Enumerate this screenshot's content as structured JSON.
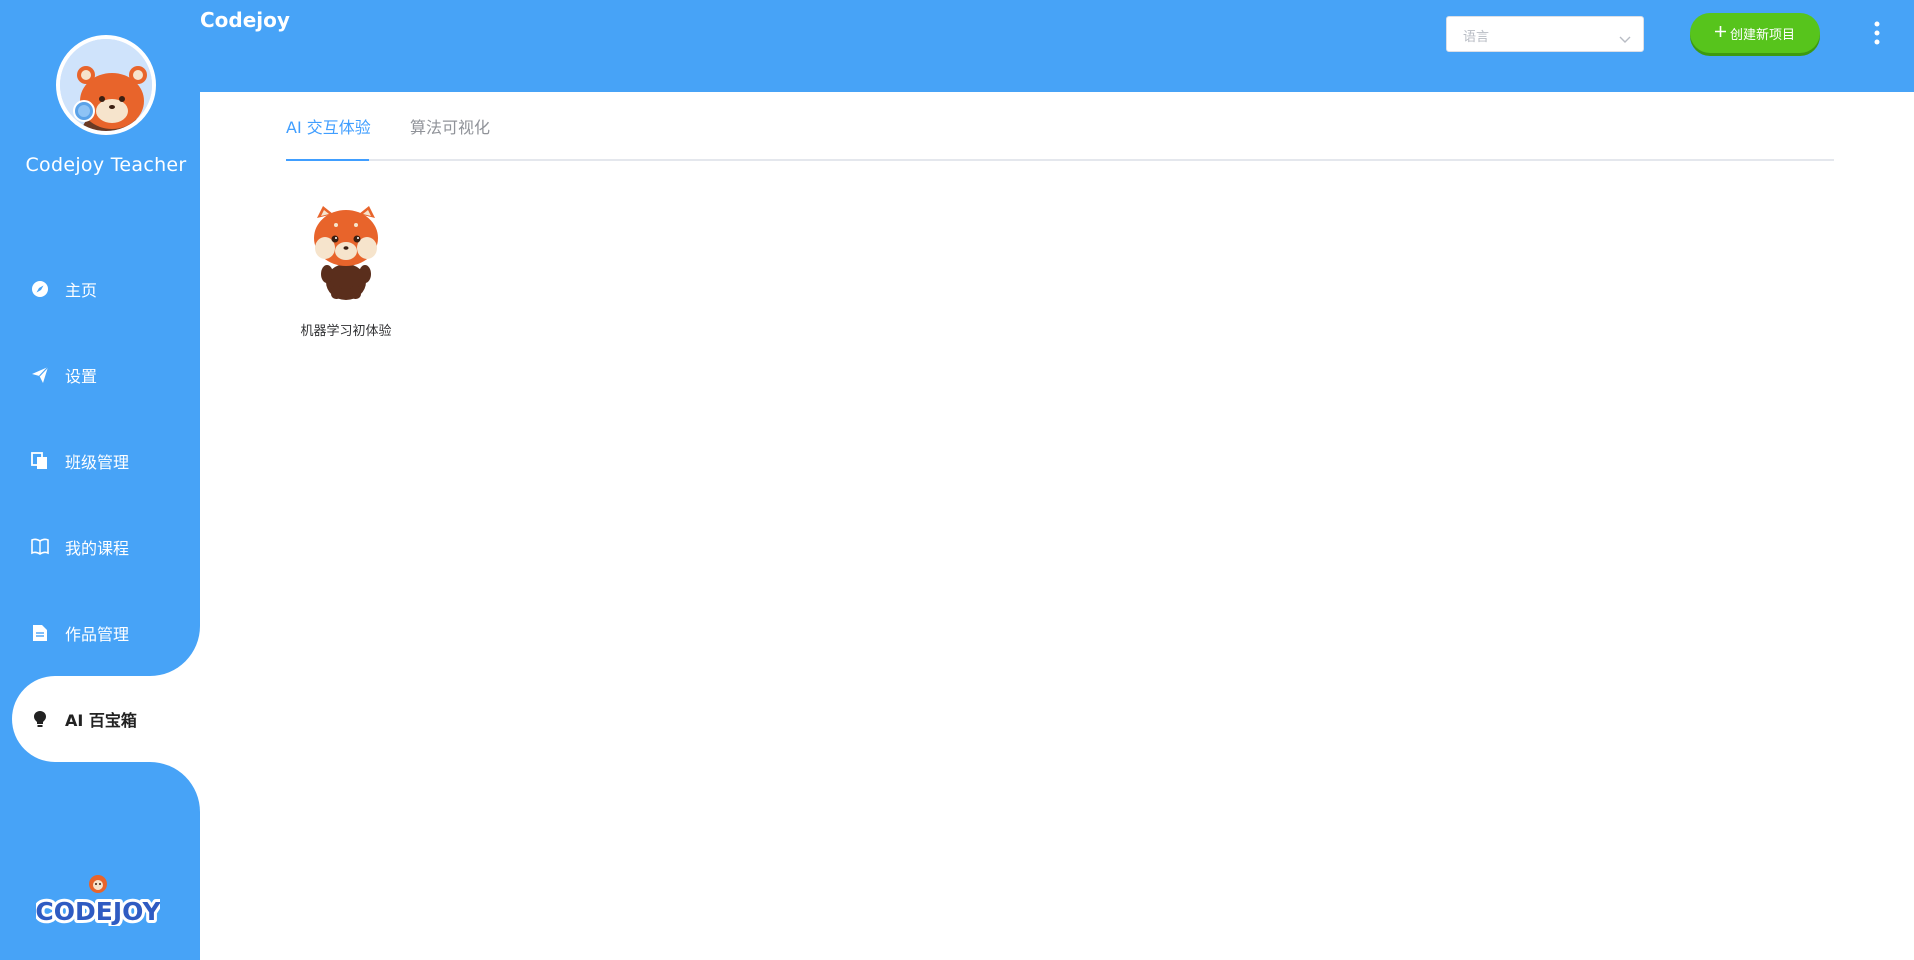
{
  "header": {
    "app_title": "Codejoy",
    "language_placeholder": "语言",
    "create_label": "创建新项目"
  },
  "sidebar": {
    "user_name": "Codejoy Teacher",
    "items": [
      {
        "label": "主页",
        "icon": "compass-icon"
      },
      {
        "label": "设置",
        "icon": "paper-plane-icon"
      },
      {
        "label": "班级管理",
        "icon": "copy-icon"
      },
      {
        "label": "我的课程",
        "icon": "book-icon"
      },
      {
        "label": "作品管理",
        "icon": "file-text-icon"
      },
      {
        "label": "AI 百宝箱",
        "icon": "bulb-icon",
        "active": true
      }
    ],
    "logo_text": "CODEJOY"
  },
  "main": {
    "tabs": [
      {
        "label": "AI 交互体验",
        "active": true
      },
      {
        "label": "算法可视化",
        "active": false
      }
    ],
    "cards": [
      {
        "label": "机器学习初体验",
        "icon": "red-panda-mascot-icon"
      }
    ]
  },
  "colors": {
    "primary_blue": "#47a3f7",
    "accent_green": "#57c41c",
    "tab_active": "#409eff"
  }
}
